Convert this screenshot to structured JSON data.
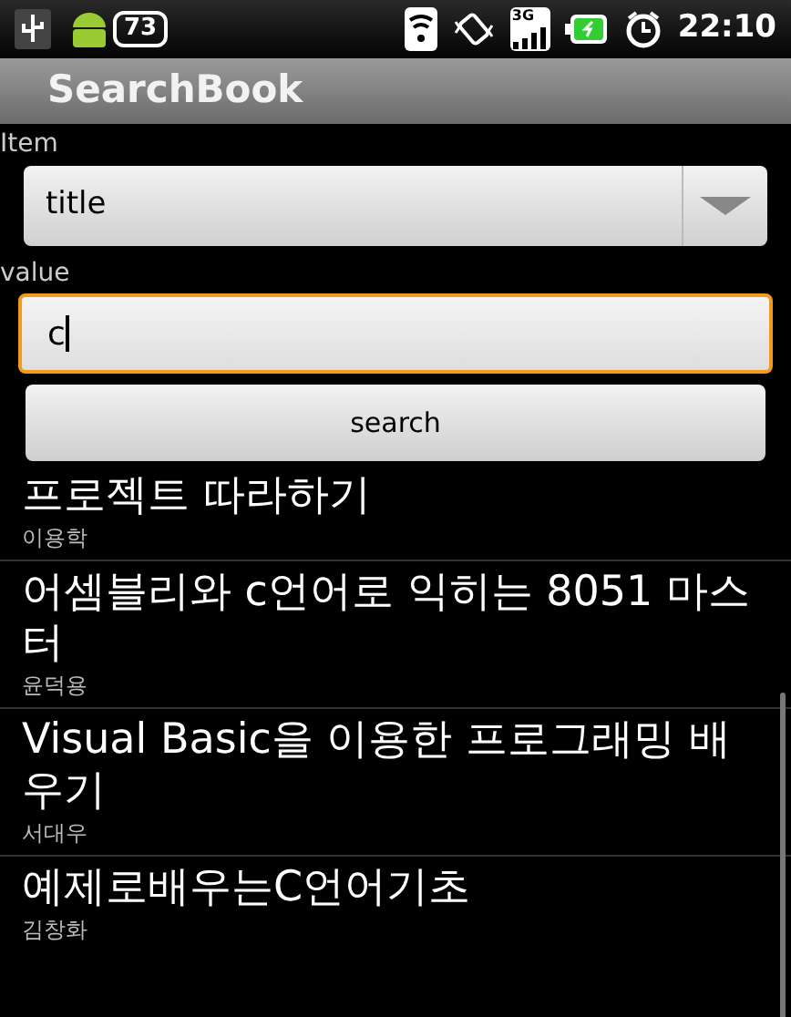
{
  "status_bar": {
    "notification_count": "73",
    "network": "3G",
    "time": "22:10"
  },
  "app_bar": {
    "title": "SearchBook"
  },
  "item_field": {
    "label": "Item",
    "value": "title"
  },
  "value_field": {
    "label": "value",
    "value": "c",
    "focused": true
  },
  "search_button": {
    "label": "search"
  },
  "results": [
    {
      "title": "프로젝트 따라하기",
      "author": "이용학"
    },
    {
      "title": "어셈블리와 c언어로 익히는 8051 마스터",
      "author": "윤덕용"
    },
    {
      "title": "Visual Basic을 이용한 프로그래밍 배우기",
      "author": "서대우"
    },
    {
      "title": "예제로배우는C언어기초",
      "author": "김창화"
    }
  ]
}
